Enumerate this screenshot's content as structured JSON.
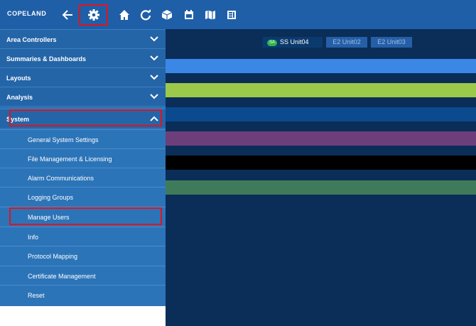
{
  "brand": {
    "logo_text": "COPELAND"
  },
  "toolbar": {
    "icons": [
      "back-arrow-icon",
      "gear-icon",
      "home-icon",
      "refresh-icon",
      "cube-icon",
      "calendar-icon",
      "map-icon",
      "panel-icon"
    ]
  },
  "tabs": [
    {
      "badge": "SA",
      "label": "SS Unit04"
    },
    {
      "label": "E2 Unit02"
    },
    {
      "label": "E2 Unit03"
    }
  ],
  "sidebar": {
    "sections": [
      {
        "label": "Area Controllers"
      },
      {
        "label": "Summaries & Dashboards"
      },
      {
        "label": "Layouts"
      },
      {
        "label": "Analysis"
      },
      {
        "label": "System"
      }
    ],
    "items": [
      {
        "label": "General System Settings"
      },
      {
        "label": "File Management & Licensing"
      },
      {
        "label": "Alarm Communications"
      },
      {
        "label": "Logging Groups"
      },
      {
        "label": "Manage Users"
      },
      {
        "label": "Info"
      },
      {
        "label": "Protocol Mapping"
      },
      {
        "label": "Certificate Management"
      },
      {
        "label": "Reset"
      }
    ]
  },
  "colors": {
    "stripes": [
      "#3b87e6",
      "#9bc94a",
      "#0b4a8f",
      "#6d3f7a",
      "#000000",
      "#3f7b5a"
    ]
  }
}
